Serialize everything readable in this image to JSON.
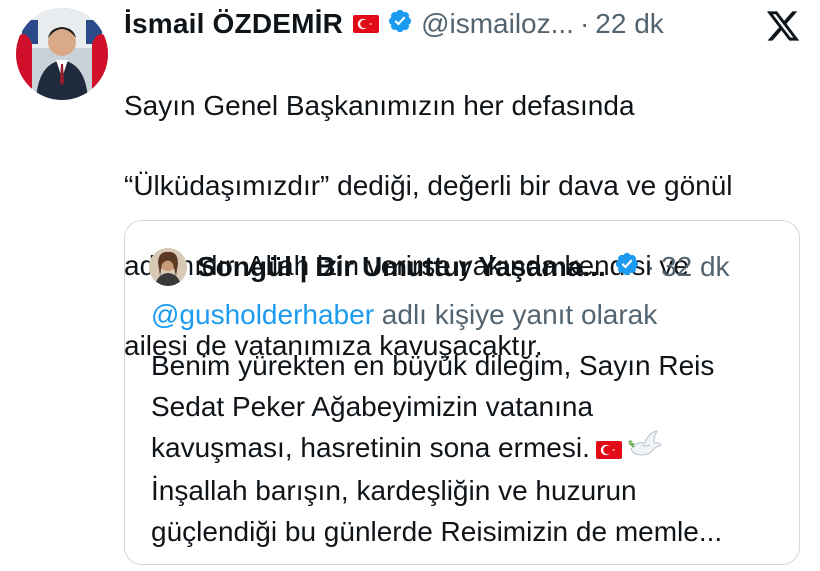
{
  "tweet": {
    "author_name": "İsmail ÖZDEMİR",
    "handle": "@ismailoz...",
    "separator": "·",
    "time": "22 dk",
    "text_lines": [
      "Sayın Genel Başkanımızın her defasında",
      "“Ülküdaşımızdır” dediği, değerli bir dava ve gönül",
      "adamıdır. Allah izin verirse yakında kendisi ve",
      "ailesi de vatanımıza kavuşacaktır."
    ]
  },
  "quoted": {
    "author_name": "Songül | Bir Umuttur Yaşama...",
    "separator": "·",
    "time": "32 dk",
    "reply_handle": "@gusholderhaber",
    "reply_suffix": " adlı kişiye yanıt olarak",
    "text_lines": [
      "Benim yürekten en büyük dileğim, Sayın Reis",
      "Sedat Peker Ağabeyimizin vatanına",
      "kavuşması, hasretinin sona ermesi.",
      "İnşallah barışın, kardeşliğin ve huzurun",
      "güçlendiği bu günlerde Reisimizin de memle..."
    ]
  },
  "icons": {
    "verified": "verified-badge-icon",
    "flag": "turkish-flag-icon",
    "dove": "dove-icon",
    "brand": "x-logo-icon"
  },
  "colors": {
    "text": "#0f1419",
    "secondary": "#536471",
    "link": "#1d9bf0",
    "verified": "#1d9bf0",
    "flag_red": "#e30a17",
    "border": "#cfd9de"
  }
}
